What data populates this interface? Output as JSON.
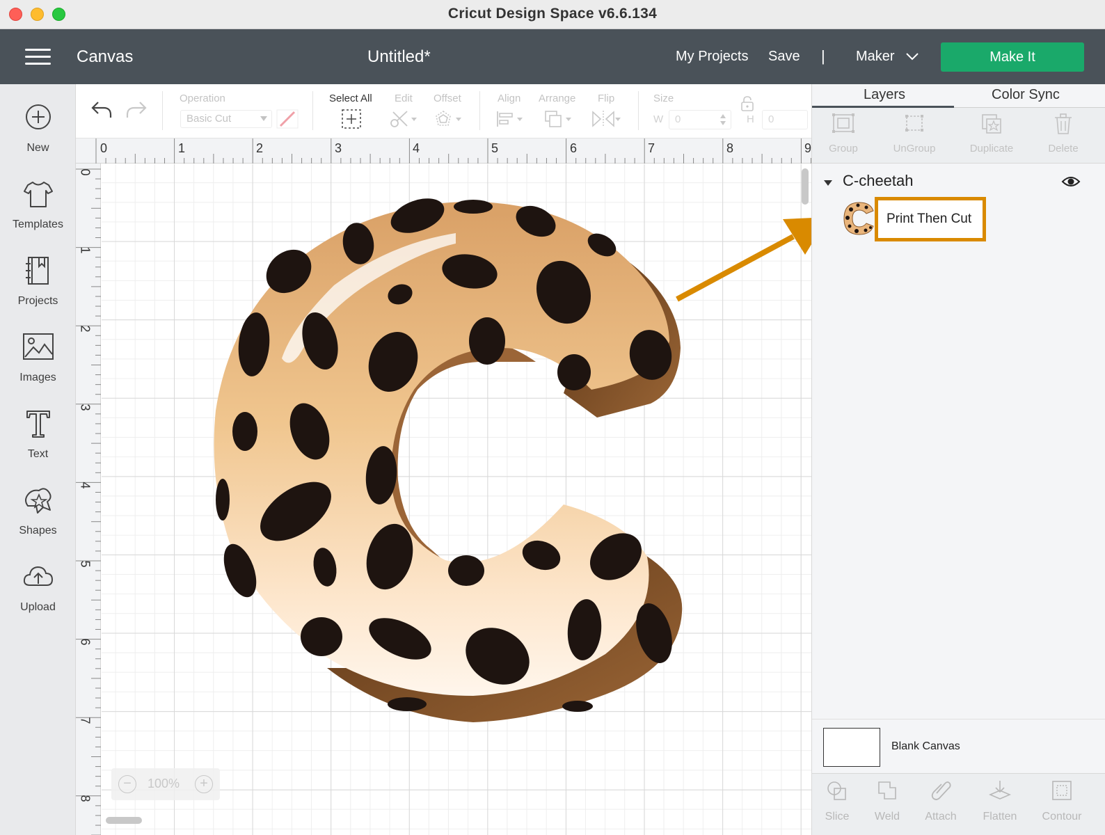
{
  "window": {
    "title": "Cricut Design Space  v6.6.134"
  },
  "header": {
    "canvas_label": "Canvas",
    "project_title": "Untitled*",
    "my_projects": "My Projects",
    "save": "Save",
    "separator": "|",
    "machine": "Maker",
    "make_it": "Make It"
  },
  "sidebar": {
    "items": [
      {
        "label": "New",
        "icon": "plus-circle-icon"
      },
      {
        "label": "Templates",
        "icon": "tshirt-icon"
      },
      {
        "label": "Projects",
        "icon": "book-icon"
      },
      {
        "label": "Images",
        "icon": "image-icon"
      },
      {
        "label": "Text",
        "icon": "text-t-icon"
      },
      {
        "label": "Shapes",
        "icon": "shapes-icon"
      },
      {
        "label": "Upload",
        "icon": "cloud-upload-icon"
      }
    ]
  },
  "toolbar": {
    "operation_label": "Operation",
    "operation_value": "Basic Cut",
    "select_all": "Select All",
    "edit": "Edit",
    "offset": "Offset",
    "align": "Align",
    "arrange": "Arrange",
    "flip": "Flip",
    "size": "Size",
    "w_label": "W",
    "w_value": "0",
    "h_label": "H",
    "h_value": "0"
  },
  "ruler": {
    "top": [
      "0",
      "1",
      "2",
      "3",
      "4",
      "5",
      "6",
      "7",
      "8",
      "9"
    ],
    "left": [
      "0",
      "1",
      "2",
      "3",
      "4",
      "5",
      "6",
      "7",
      "8"
    ]
  },
  "zoom": {
    "value": "100%",
    "minus": "−",
    "plus": "+"
  },
  "panel": {
    "tabs": [
      "Layers",
      "Color Sync"
    ],
    "tools": [
      "Group",
      "UnGroup",
      "Duplicate",
      "Delete"
    ],
    "group_name": "C-cheetah",
    "layer_name": "Print Then Cut",
    "blank_canvas": "Blank Canvas",
    "bottom_tools": [
      "Slice",
      "Weld",
      "Attach",
      "Flatten",
      "Contour"
    ]
  },
  "colors": {
    "header_bg": "#4a5259",
    "make_it_green": "#1aa96a",
    "highlight_orange": "#d98a00"
  }
}
